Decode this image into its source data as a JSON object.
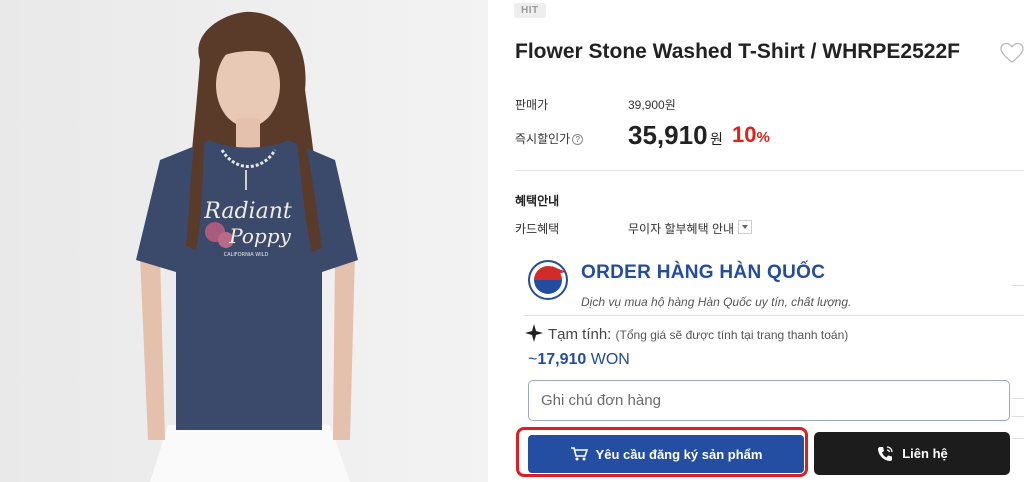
{
  "product": {
    "badge": "HIT",
    "title": "Flower Stone Washed T-Shirt / WHRPE2522F",
    "list_price_label": "판매가",
    "list_price": "39,900원",
    "sale_label": "즉시할인가",
    "sale_help_icon": "?",
    "sale_price": "35,910",
    "sale_currency": "원",
    "discount": "10",
    "discount_unit": "%",
    "benefit_title": "혜택안내",
    "card_label": "카드혜택",
    "card_value": "무이자 할부혜택 안내"
  },
  "order": {
    "title": "ORDER HÀNG HÀN QUỐC",
    "subtitle": "Dịch vụ mua hộ hàng Hàn Quốc uy tín, chất lượng.",
    "estimate_label": "Tạm tính:",
    "estimate_note": "(Tổng giá sẽ được tính tại trang thanh toán)",
    "estimate_prefix": "~",
    "estimate_value": "17,910",
    "estimate_currency": "WON",
    "note_placeholder": "Ghi chú đơn hàng",
    "request_button": "Yêu cầu đăng ký sản phẩm",
    "contact_button": "Liên hệ"
  },
  "photo": {
    "shirt_print_line1": "Radiant",
    "shirt_print_line2": "Poppy",
    "shirt_print_small": "CALIFORNIA WILD"
  },
  "icons": [
    "heart-icon",
    "question-icon",
    "dropdown-icon",
    "logo-icon",
    "sparkle-icon",
    "cart-icon",
    "phone-icon"
  ],
  "colors": {
    "accent_blue": "#234ea2",
    "discount_red": "#e0201a",
    "highlight_red": "#e01e22",
    "dark_button": "#1c1c1c"
  }
}
